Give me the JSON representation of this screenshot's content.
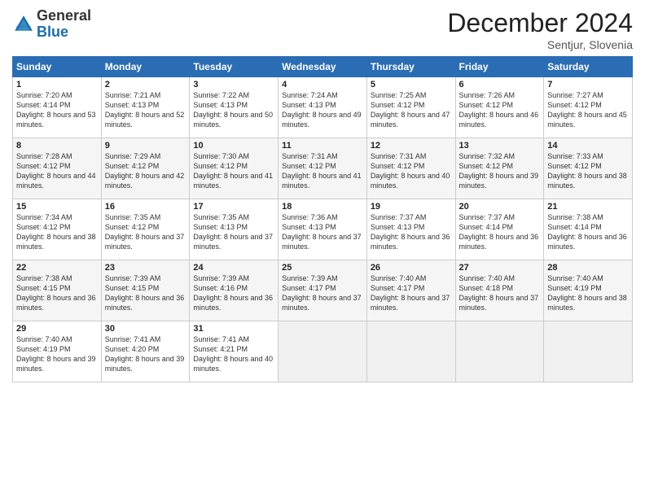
{
  "logo": {
    "general": "General",
    "blue": "Blue"
  },
  "title": "December 2024",
  "location": "Sentjur, Slovenia",
  "days_header": [
    "Sunday",
    "Monday",
    "Tuesday",
    "Wednesday",
    "Thursday",
    "Friday",
    "Saturday"
  ],
  "weeks": [
    [
      {
        "day": "1",
        "sunrise": "7:20 AM",
        "sunset": "4:14 PM",
        "daylight": "8 hours and 53 minutes."
      },
      {
        "day": "2",
        "sunrise": "7:21 AM",
        "sunset": "4:13 PM",
        "daylight": "8 hours and 52 minutes."
      },
      {
        "day": "3",
        "sunrise": "7:22 AM",
        "sunset": "4:13 PM",
        "daylight": "8 hours and 50 minutes."
      },
      {
        "day": "4",
        "sunrise": "7:24 AM",
        "sunset": "4:13 PM",
        "daylight": "8 hours and 49 minutes."
      },
      {
        "day": "5",
        "sunrise": "7:25 AM",
        "sunset": "4:12 PM",
        "daylight": "8 hours and 47 minutes."
      },
      {
        "day": "6",
        "sunrise": "7:26 AM",
        "sunset": "4:12 PM",
        "daylight": "8 hours and 46 minutes."
      },
      {
        "day": "7",
        "sunrise": "7:27 AM",
        "sunset": "4:12 PM",
        "daylight": "8 hours and 45 minutes."
      }
    ],
    [
      {
        "day": "8",
        "sunrise": "7:28 AM",
        "sunset": "4:12 PM",
        "daylight": "8 hours and 44 minutes."
      },
      {
        "day": "9",
        "sunrise": "7:29 AM",
        "sunset": "4:12 PM",
        "daylight": "8 hours and 42 minutes."
      },
      {
        "day": "10",
        "sunrise": "7:30 AM",
        "sunset": "4:12 PM",
        "daylight": "8 hours and 41 minutes."
      },
      {
        "day": "11",
        "sunrise": "7:31 AM",
        "sunset": "4:12 PM",
        "daylight": "8 hours and 41 minutes."
      },
      {
        "day": "12",
        "sunrise": "7:31 AM",
        "sunset": "4:12 PM",
        "daylight": "8 hours and 40 minutes."
      },
      {
        "day": "13",
        "sunrise": "7:32 AM",
        "sunset": "4:12 PM",
        "daylight": "8 hours and 39 minutes."
      },
      {
        "day": "14",
        "sunrise": "7:33 AM",
        "sunset": "4:12 PM",
        "daylight": "8 hours and 38 minutes."
      }
    ],
    [
      {
        "day": "15",
        "sunrise": "7:34 AM",
        "sunset": "4:12 PM",
        "daylight": "8 hours and 38 minutes."
      },
      {
        "day": "16",
        "sunrise": "7:35 AM",
        "sunset": "4:12 PM",
        "daylight": "8 hours and 37 minutes."
      },
      {
        "day": "17",
        "sunrise": "7:35 AM",
        "sunset": "4:13 PM",
        "daylight": "8 hours and 37 minutes."
      },
      {
        "day": "18",
        "sunrise": "7:36 AM",
        "sunset": "4:13 PM",
        "daylight": "8 hours and 37 minutes."
      },
      {
        "day": "19",
        "sunrise": "7:37 AM",
        "sunset": "4:13 PM",
        "daylight": "8 hours and 36 minutes."
      },
      {
        "day": "20",
        "sunrise": "7:37 AM",
        "sunset": "4:14 PM",
        "daylight": "8 hours and 36 minutes."
      },
      {
        "day": "21",
        "sunrise": "7:38 AM",
        "sunset": "4:14 PM",
        "daylight": "8 hours and 36 minutes."
      }
    ],
    [
      {
        "day": "22",
        "sunrise": "7:38 AM",
        "sunset": "4:15 PM",
        "daylight": "8 hours and 36 minutes."
      },
      {
        "day": "23",
        "sunrise": "7:39 AM",
        "sunset": "4:15 PM",
        "daylight": "8 hours and 36 minutes."
      },
      {
        "day": "24",
        "sunrise": "7:39 AM",
        "sunset": "4:16 PM",
        "daylight": "8 hours and 36 minutes."
      },
      {
        "day": "25",
        "sunrise": "7:39 AM",
        "sunset": "4:17 PM",
        "daylight": "8 hours and 37 minutes."
      },
      {
        "day": "26",
        "sunrise": "7:40 AM",
        "sunset": "4:17 PM",
        "daylight": "8 hours and 37 minutes."
      },
      {
        "day": "27",
        "sunrise": "7:40 AM",
        "sunset": "4:18 PM",
        "daylight": "8 hours and 37 minutes."
      },
      {
        "day": "28",
        "sunrise": "7:40 AM",
        "sunset": "4:19 PM",
        "daylight": "8 hours and 38 minutes."
      }
    ],
    [
      {
        "day": "29",
        "sunrise": "7:40 AM",
        "sunset": "4:19 PM",
        "daylight": "8 hours and 39 minutes."
      },
      {
        "day": "30",
        "sunrise": "7:41 AM",
        "sunset": "4:20 PM",
        "daylight": "8 hours and 39 minutes."
      },
      {
        "day": "31",
        "sunrise": "7:41 AM",
        "sunset": "4:21 PM",
        "daylight": "8 hours and 40 minutes."
      },
      null,
      null,
      null,
      null
    ]
  ],
  "labels": {
    "sunrise": "Sunrise:",
    "sunset": "Sunset:",
    "daylight": "Daylight:"
  }
}
